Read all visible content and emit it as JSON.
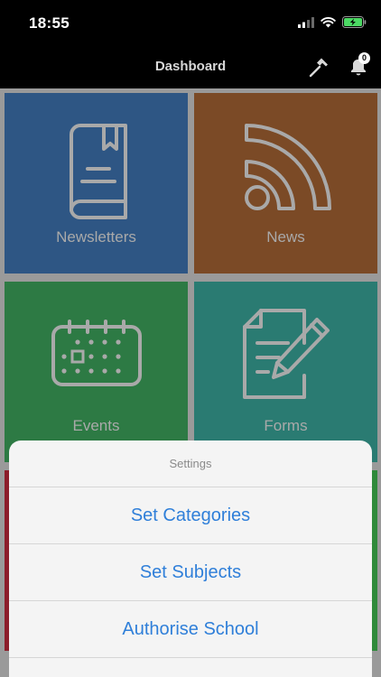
{
  "status_bar": {
    "time": "18:55"
  },
  "nav": {
    "title": "Dashboard",
    "notification_count": "0"
  },
  "tiles": [
    {
      "label": "Newsletters",
      "color": "#2e5684",
      "icon": "book-icon"
    },
    {
      "label": "News",
      "color": "#7b4a26",
      "icon": "rss-icon"
    },
    {
      "label": "Events",
      "color": "#2d7a44",
      "icon": "calendar-icon"
    },
    {
      "label": "Forms",
      "color": "#2a7b72",
      "icon": "form-pencil-icon"
    }
  ],
  "action_sheet": {
    "title": "Settings",
    "items": [
      {
        "label": "Set Categories"
      },
      {
        "label": "Set Subjects"
      },
      {
        "label": "Authorise School"
      }
    ]
  },
  "colors": {
    "accent_blue": "#2f7fd9",
    "icon_gray": "#a9a9a9",
    "battery_green": "#4cd964"
  }
}
